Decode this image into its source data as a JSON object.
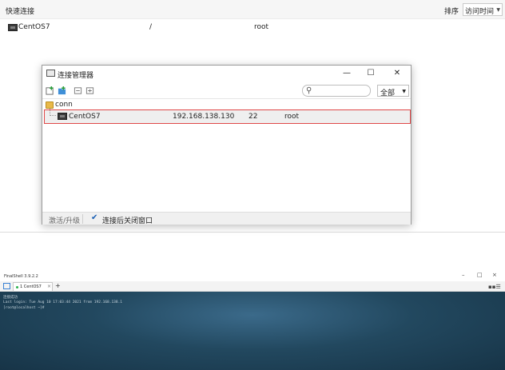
{
  "quick_connect": {
    "title": "快速连接",
    "sort_label": "排序",
    "sort_value": "访问时间",
    "rows": [
      {
        "name": "CentOS7",
        "path": "/",
        "user": "root"
      }
    ]
  },
  "dialog": {
    "title": "连接管理器",
    "window_buttons": {
      "minimize": "—",
      "maximize": "☐",
      "close": "✕"
    },
    "search_placeholder": "",
    "scope_value": "全部",
    "folder": "conn",
    "connection": {
      "name": "CentOS7",
      "host": "192.168.138.130",
      "port": "22",
      "user": "root"
    },
    "footer": {
      "activate": "激活/升级",
      "checkbox_label": "连接后关闭窗口",
      "checkbox_checked": true
    }
  },
  "finalshell": {
    "title": "FinalShell 3.9.2.2",
    "tab_label": "1 CentOS7",
    "window_buttons": {
      "minimize": "–",
      "maximize": "□",
      "close": "×"
    },
    "terminal_lines": [
      "连接成功",
      "Last login: Tue Aug 10 17:03:44 2021 from 192.168.138.1",
      "[root@localhost ~]#"
    ]
  },
  "colors": {
    "selection_border": "#e04848",
    "terminal_bg": "#22485f",
    "status_green": "#2bb24c"
  }
}
